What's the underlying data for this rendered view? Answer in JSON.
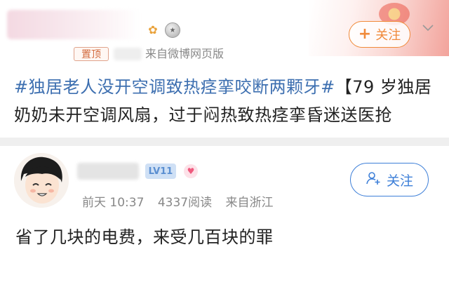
{
  "post": {
    "badges": [
      "gold-medal-icon",
      "silver-medal-icon"
    ],
    "follow_label": "关注",
    "pinned_label": "置顶",
    "source": "来自微博网页版",
    "hashtag": "#独居老人没开空调致热痉挛咬断两颗牙#",
    "body": "【79 岁独居奶奶未开空调风扇，过于闷热致热痉挛昏迷送医抢"
  },
  "comment": {
    "level": "LV11",
    "meta": {
      "time": "前天 10:37",
      "reads": "4337阅读",
      "location": "来自浙江"
    },
    "follow_label": "关注",
    "text": "省了几块的电费，来受几百块的罪"
  },
  "colors": {
    "hashtag": "#3d6fb0",
    "follow_orange": "#f08a3a",
    "follow_blue": "#3d7fd8",
    "level_badge_bg": "#cfe0f5"
  }
}
